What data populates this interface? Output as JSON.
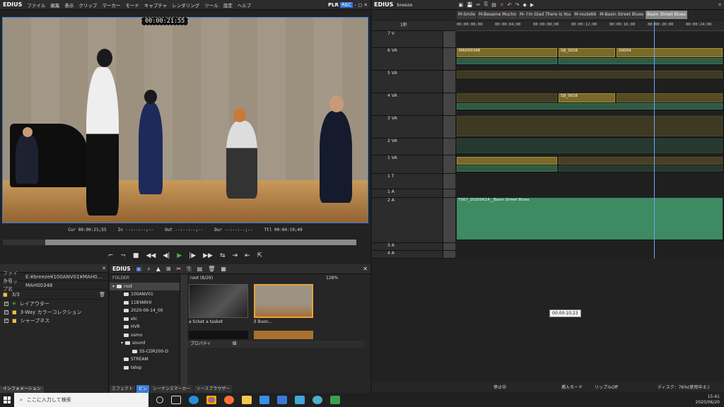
{
  "player": {
    "app": "EDIUS",
    "menu": [
      "ファイル",
      "編集",
      "表示",
      "クリップ",
      "マーカー",
      "モード",
      "キャプチャ",
      "レンダリング",
      "ツール",
      "設定",
      "ヘルプ"
    ],
    "plr": "PLR",
    "rec": "REC",
    "overlay_timecode": "00:00:21:55",
    "cur_label": "Cur",
    "cur": "00:00:21;55",
    "in_label": "In",
    "in": "--:--:--;--",
    "out_label": "Out",
    "out": "--:--:--;--",
    "dur_label": "Dur",
    "dur": "--:--:--;--",
    "ttl_label": "Ttl",
    "ttl": "00:04:19;49"
  },
  "info_panel": {
    "file_label": "ファイル名",
    "file_value": "E:¥breeze¥100ANV01¥MAH0...",
    "clip_label": "クリップ名",
    "clip_value": "MAH00348",
    "count": "3/3",
    "effects": [
      "レイアウター",
      "3-Way カラーコレクション",
      "シャープネス"
    ],
    "tab": "インフォメーション"
  },
  "bin": {
    "app": "EDIUS",
    "folder_header": "FOLDER",
    "folders": [
      "root",
      "100ANV01",
      "118YARHI",
      "2020-06-14_00",
      "etc",
      "HVR",
      "osmo",
      "sound",
      "SS-CDR200-D",
      "STREAM",
      "telop"
    ],
    "path": "root (8/29)",
    "zoom": "128%",
    "clips": [
      "a ticket a tasket",
      "Il Buon..."
    ],
    "prop_label": "プロパティ",
    "value_label": "値",
    "tabs": [
      "エフェクト",
      "ビン",
      "シーケンスマーカー",
      "ソースブラウザー"
    ]
  },
  "timeline": {
    "app": "EDIUS",
    "project": "breeze",
    "sequences": [
      "M-Smile",
      "M-Besame Mucho",
      "M- I'm Glad There Is You",
      "M-route66",
      "M-Basin Street Blues",
      "Basin Street Blues"
    ],
    "scale": "1秒",
    "ruler": [
      "00:00:00;00",
      "00:00:04;00",
      "00:00:08;00",
      "00:00:12;00",
      "00:00:16;00",
      "00:00:20;00",
      "00:00:24;00"
    ],
    "tracks": [
      "7 V",
      "6 VA",
      "5 VA",
      "4 VA",
      "3 VA",
      "2 VA",
      "1 VA",
      "1 T",
      "1 A",
      "2 A",
      "3 A",
      "4 A"
    ],
    "clip_labels": [
      "MAH00348",
      "DJI_0016",
      "00004",
      "DJI_0016",
      "T007_20200614__Basin Street Blues"
    ],
    "tooltip": "00:00:10;23",
    "status": [
      "停止中",
      "挿入モード",
      "リップルOff",
      "ディスク：76%(使用中:E:)"
    ]
  },
  "taskbar": {
    "search_placeholder": "ここに入力して検索",
    "time": "15:41",
    "date": "2020/06/20"
  }
}
